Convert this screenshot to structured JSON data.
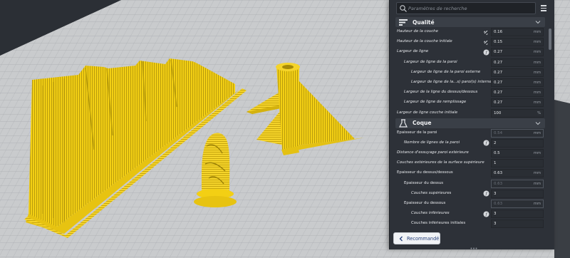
{
  "search": {
    "placeholder": "Paramètres de recherche"
  },
  "colors": {
    "model_yellow": "#f3cf14",
    "viewport_bg": "#2b2f35",
    "build_plate": "#c9cbcd",
    "panel_bg": "#2d3138"
  },
  "icons": {
    "search": "search-icon",
    "menu": "menu-icon",
    "quality": "quality-icon",
    "shell": "shell-icon",
    "link": "link-icon",
    "formula": "formula-icon",
    "chevron": "chevron-down-icon",
    "back": "chevron-left-icon"
  },
  "categories": [
    {
      "label": "Qualité"
    },
    {
      "label": "Coque"
    }
  ],
  "quality_rows": [
    {
      "label": "Hauteur de la couche",
      "value": "0.16",
      "unit": "mm",
      "icon": "link"
    },
    {
      "label": "Hauteur de la couche initiale",
      "value": "0.15",
      "unit": "mm",
      "icon": "link"
    },
    {
      "label": "Largeur de ligne",
      "value": "0.27",
      "unit": "mm",
      "icon": "formula"
    },
    {
      "label": "Largeur de ligne de la paroi",
      "value": "0.27",
      "unit": "mm"
    },
    {
      "label": "Largeur de ligne de la paroi externe",
      "value": "0.27",
      "unit": "mm"
    },
    {
      "label": "Largeur de ligne de la...s) paroi(s) interne(s)",
      "value": "0.27",
      "unit": "mm"
    },
    {
      "label": "Largeur de la ligne du dessus/dessous",
      "value": "0.27",
      "unit": "mm"
    },
    {
      "label": "Largeur de ligne de remplissage",
      "value": "0.27",
      "unit": "mm"
    },
    {
      "label": "Largeur de ligne couche initiale",
      "value": "100",
      "unit": "%"
    }
  ],
  "shell_rows": [
    {
      "label": "Épaisseur de la paroi",
      "value": "0.54",
      "unit": "mm"
    },
    {
      "label": "Nombre de lignes de la paroi",
      "value": "2",
      "unit": "",
      "icon": "formula"
    },
    {
      "label": "Distance d'essuyage paroi extérieure",
      "value": "0.5",
      "unit": "mm"
    },
    {
      "label": "Couches extérieures de la surface supérieure",
      "value": "1",
      "unit": ""
    },
    {
      "label": "Épaisseur du dessus/dessous",
      "value": "0.63",
      "unit": "mm"
    },
    {
      "label": "Épaisseur du dessus",
      "value": "0.63",
      "unit": "mm"
    },
    {
      "label": "Couches supérieures",
      "value": "3",
      "unit": "",
      "icon": "formula"
    },
    {
      "label": "Épaisseur du dessous",
      "value": "0.63",
      "unit": "mm"
    },
    {
      "label": "Couches inférieures",
      "value": "3",
      "unit": "",
      "icon": "formula"
    },
    {
      "label": "Couches inférieures initiales",
      "value": "3",
      "unit": ""
    }
  ],
  "footer": {
    "recommended_label": "Recommandé"
  }
}
